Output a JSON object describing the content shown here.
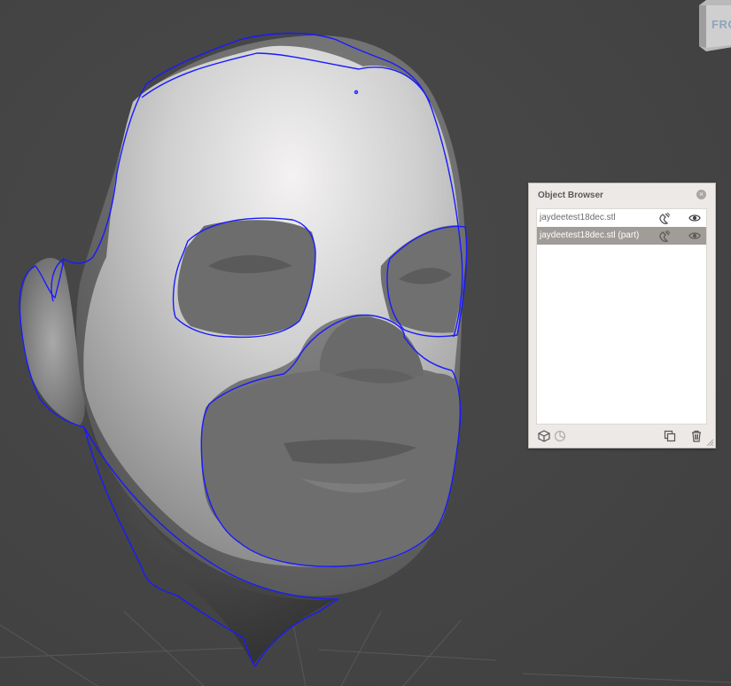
{
  "viewport": {
    "background": "#464646",
    "view_cube_label": "FRO"
  },
  "object_browser": {
    "title": "Object Browser",
    "close_label": "×",
    "items": [
      {
        "name": "jaydeetest18dec.stl",
        "selected": false,
        "icons": [
          "magnet-icon",
          "eye-icon"
        ]
      },
      {
        "name": "jaydeetest18dec.stl (part)",
        "selected": true,
        "icons": [
          "magnet-icon",
          "eye-icon"
        ]
      }
    ],
    "footer_icons": [
      "cube-icon",
      "pie-icon",
      "duplicate-icon",
      "trash-icon"
    ]
  },
  "colors": {
    "selection_outline": "#1a1aff",
    "selected_row": "#a09c98",
    "panel_bg": "#ece9e6"
  }
}
